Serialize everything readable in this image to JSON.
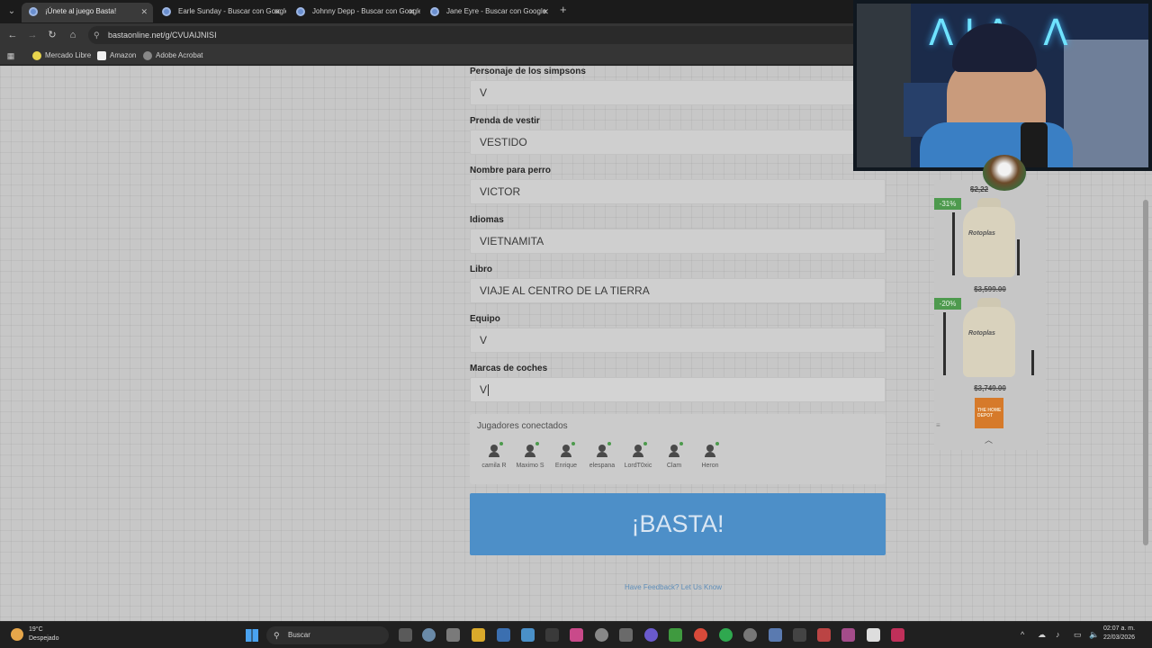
{
  "browser": {
    "tabs": [
      {
        "title": "¡Únete al juego Basta!",
        "active": true
      },
      {
        "title": "Earle Sunday - Buscar con Google",
        "active": false
      },
      {
        "title": "Johnny Depp - Buscar con Google",
        "active": false
      },
      {
        "title": "Jane Eyre - Buscar con Google",
        "active": false
      }
    ],
    "url": "bastaonline.net/g/CVUAIJNISI",
    "bookmarks": [
      "Mercado Libre",
      "Amazon",
      "Adobe Acrobat"
    ]
  },
  "form": {
    "fields": [
      {
        "label": "Personaje de los simpsons",
        "value": "V"
      },
      {
        "label": "Prenda de vestir",
        "value": "VESTIDO"
      },
      {
        "label": "Nombre para perro",
        "value": "VICTOR"
      },
      {
        "label": "Idiomas",
        "value": "VIETNAMITA"
      },
      {
        "label": "Libro",
        "value": "VIAJE AL CENTRO DE LA TIERRA"
      },
      {
        "label": "Equipo",
        "value": "V"
      },
      {
        "label": "Marcas de coches",
        "value": "V"
      }
    ],
    "players_title": "Jugadores conectados",
    "players": [
      "camila R",
      "Maximo S",
      "Enrique",
      "elespana",
      "LordT0xic",
      "Clam",
      "Heron"
    ],
    "basta_label": "¡BASTA!",
    "feedback_link": "Have Feedback? Let Us Know"
  },
  "ad": {
    "top_price": "$2,22",
    "items": [
      {
        "discount": "-31%",
        "brand": "Rotoplas",
        "old_price": "$3,599.00"
      },
      {
        "discount": "-20%",
        "brand": "Rotoplas",
        "old_price": "$3,749.00"
      }
    ],
    "store": "THE HOME DEPOT"
  },
  "webcam": {
    "neon_text": "ɅIɅ Ʌ"
  },
  "taskbar": {
    "weather_temp": "19°C",
    "weather_desc": "Despejado",
    "search_label": "Buscar",
    "time": "02:07 a. m.",
    "date": "22/03/2026"
  },
  "colors": {
    "basta": "#4d8fc8",
    "badge": "#4e9a4e",
    "feedback": "#5d8db8"
  }
}
